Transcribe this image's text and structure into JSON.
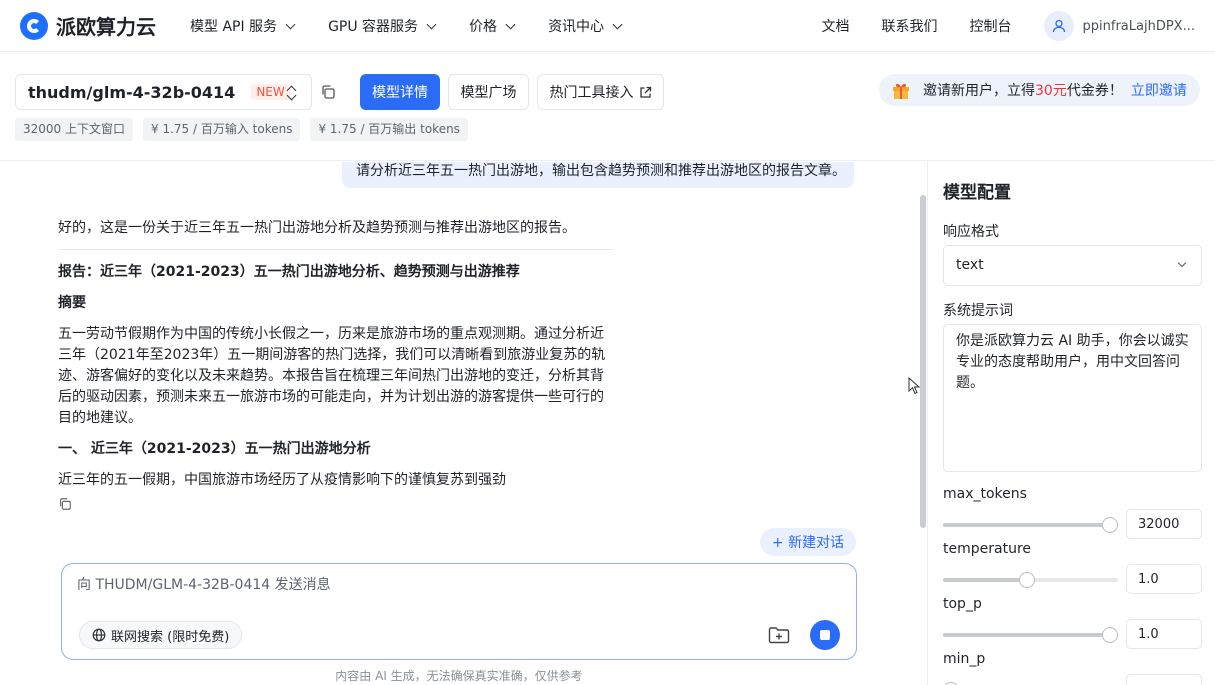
{
  "brand": {
    "name": "派欧算力云",
    "accent": "#2b6cf6"
  },
  "nav": {
    "menu": [
      "模型 API 服务",
      "GPU 容器服务",
      "价格",
      "资讯中心"
    ],
    "links": [
      "文档",
      "联系我们",
      "控制台"
    ],
    "user": "ppinfraLajhDPX..."
  },
  "toolbar": {
    "model": "thudm/glm-4-32b-0414",
    "new_tag": "NEW",
    "buttons": {
      "detail": "模型详情",
      "plaza": "模型广场",
      "tools": "热门工具接入"
    },
    "chips": [
      "32000 上下文窗口",
      "¥ 1.75 / 百万输入 tokens",
      "¥ 1.75 / 百万输出 tokens"
    ],
    "invite": {
      "text": "邀请新用户，立得 ",
      "amount": "30元",
      "suffix": " 代金券！",
      "link": "立即邀请"
    }
  },
  "chat": {
    "user_message": "请分析近三年五一热门出游地，输出包含趋势预测和推荐出游地区的报告文章。",
    "intro": "好的，这是一份关于近三年五一热门出游地分析及趋势预测与推荐出游地区的报告。",
    "report_title": "报告：近三年（2021-2023）五一热门出游地分析、趋势预测与出游推荐",
    "abstract_heading": "摘要",
    "abstract": "五一劳动节假期作为中国的传统小长假之一，历来是旅游市场的重点观测期。通过分析近三年（2021年至2023年）五一期间游客的热门选择，我们可以清晰看到旅游业复苏的轨迹、游客偏好的变化以及未来趋势。本报告旨在梳理三年间热门出游地的变迁，分析其背后的驱动因素，预测未来五一旅游市场的可能走向，并为计划出游的游客提供一些可行的目的地建议。",
    "section1_heading": "一、 近三年（2021-2023）五一热门出游地分析",
    "section1_text": "近三年的五一假期，中国旅游市场经历了从疫情影响下的谨慎复苏到强劲",
    "new_chat": "+ 新建对话",
    "input_placeholder": "向 THUDM/GLM-4-32B-0414 发送消息",
    "web_search": "联网搜索 (限时免费)",
    "disclaimer": "内容由 AI 生成，无法确保真实准确，仅供参考"
  },
  "config": {
    "title": "模型配置",
    "response_format_label": "响应格式",
    "response_format_value": "text",
    "system_prompt_label": "系统提示词",
    "system_prompt": "你是派欧算力云 AI 助手，你会以诚实专业的态度帮助用户，用中文回答问题。",
    "params": [
      {
        "label": "max_tokens",
        "value": "32000",
        "fraction": 1.0
      },
      {
        "label": "temperature",
        "value": "1.0",
        "fraction": 0.5
      },
      {
        "label": "top_p",
        "value": "1.0",
        "fraction": 1.0
      },
      {
        "label": "min_p",
        "value": "",
        "fraction": 0.0
      }
    ]
  }
}
